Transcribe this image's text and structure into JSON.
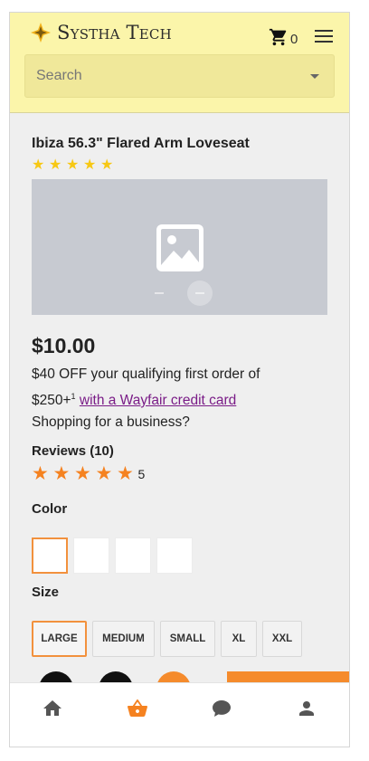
{
  "header": {
    "brand": "Systha Tech",
    "cart_count": "0",
    "search_placeholder": "Search"
  },
  "product": {
    "title": "Ibiza 56.3\" Flared Arm Loveseat",
    "rating_stars": 5,
    "price": "$10.00",
    "promo_text": "$40 OFF your qualifying first order of $250+",
    "promo_sup": "1",
    "promo_link": "with a Wayfair credit card",
    "business_text": "Shopping for a business?",
    "reviews_title": "Reviews (10)",
    "reviews_rating": "5",
    "color_label": "Color",
    "colors": [
      "#ffffff",
      "#ffffff",
      "#ffffff",
      "#ffffff"
    ],
    "selected_color_index": 0,
    "size_label": "Size",
    "sizes": [
      "LARGE",
      "MEDIUM",
      "SMALL",
      "XL",
      "XXL"
    ],
    "selected_size": "LARGE"
  },
  "bottom_nav": {
    "items": [
      "home-icon",
      "basket-icon",
      "chat-icon",
      "profile-icon"
    ],
    "active": "basket-icon"
  },
  "colors": {
    "header_bg": "#fbf5aa",
    "accent": "#f58220",
    "star_yellow": "#f7c814",
    "link": "#7a1c87"
  }
}
